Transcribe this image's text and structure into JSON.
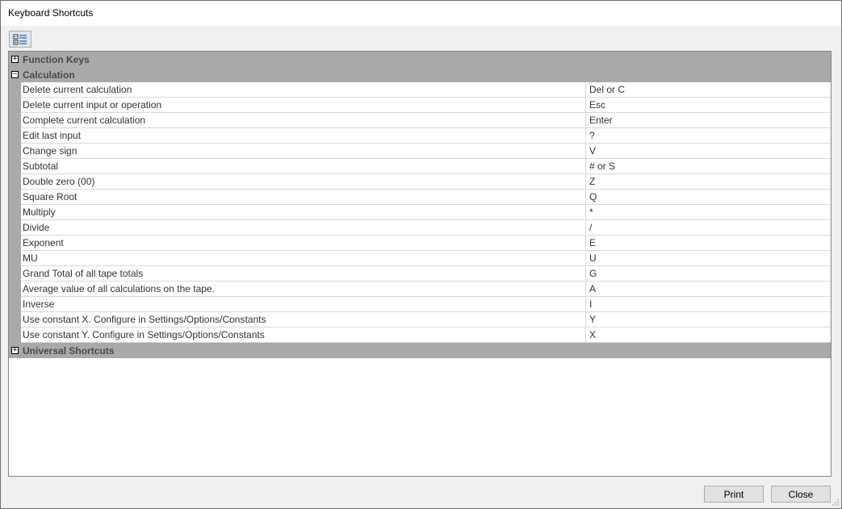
{
  "window": {
    "title": "Keyboard Shortcuts"
  },
  "toolbar": {
    "icon": "categorized-view-icon"
  },
  "categories": [
    {
      "label": "Function Keys",
      "expanded": false,
      "symbol": "+"
    },
    {
      "label": "Calculation",
      "expanded": true,
      "symbol": "−"
    },
    {
      "label": "Universal Shortcuts",
      "expanded": false,
      "symbol": "+"
    }
  ],
  "shortcuts": [
    {
      "action": "Delete current calculation",
      "key": "Del or C"
    },
    {
      "action": "Delete current input or operation",
      "key": "Esc"
    },
    {
      "action": "Complete current calculation",
      "key": "Enter"
    },
    {
      "action": "Edit last input",
      "key": "?"
    },
    {
      "action": "Change sign",
      "key": "V"
    },
    {
      "action": "Subtotal",
      "key": "# or S"
    },
    {
      "action": "Double zero (00)",
      "key": "Z"
    },
    {
      "action": "Square Root",
      "key": "Q"
    },
    {
      "action": "Multiply",
      "key": "*"
    },
    {
      "action": "Divide",
      "key": "/"
    },
    {
      "action": "Exponent",
      "key": "E"
    },
    {
      "action": "MU",
      "key": "U"
    },
    {
      "action": "Grand Total of all tape totals",
      "key": "G"
    },
    {
      "action": "Average value of all calculations on the tape.",
      "key": "A"
    },
    {
      "action": "Inverse",
      "key": "I"
    },
    {
      "action": "Use constant X. Configure in Settings/Options/Constants",
      "key": "Y"
    },
    {
      "action": "Use constant Y. Configure in Settings/Options/Constants",
      "key": "X"
    }
  ],
  "buttons": {
    "print": "Print",
    "close": "Close"
  },
  "colors": {
    "category_bg": "#a9a9a9",
    "grid_bg": "#ffffff",
    "window_bg": "#f0f0f0"
  }
}
